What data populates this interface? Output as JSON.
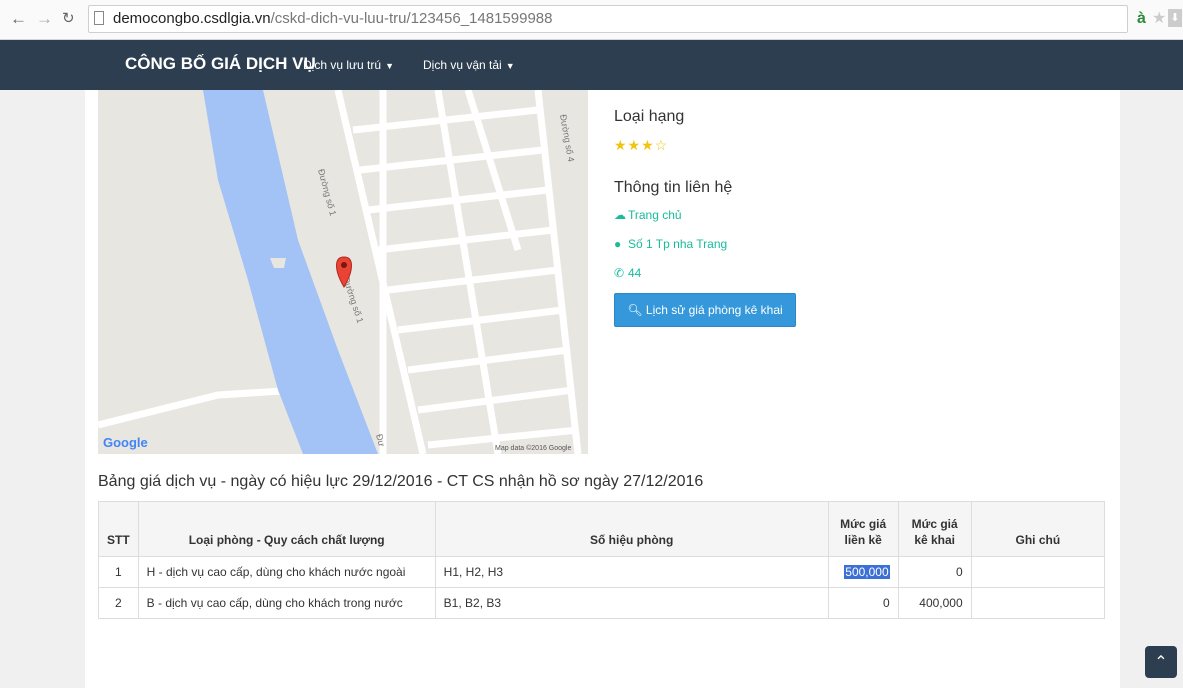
{
  "browser": {
    "url_host": "democongbo.csdlgia.vn",
    "url_path": "/cskd-dich-vu-luu-tru/123456_1481599988",
    "ext_icon": "à"
  },
  "navbar": {
    "brand": "CÔNG BỐ GIÁ DỊCH VỤ",
    "items": [
      {
        "label": "Dịch vụ lưu trú"
      },
      {
        "label": "Dịch vụ vận tải"
      }
    ]
  },
  "map": {
    "google_label": "Google",
    "attribution": "Map data ©2016 Google",
    "street_labels": [
      "Đường số 1",
      "Đường số 1",
      "Đường số 4",
      "Đư"
    ]
  },
  "info": {
    "rank_title": "Loại hạng",
    "stars": "★★★☆",
    "star_rating": 3,
    "contact_title": "Thông tin liên hệ",
    "homepage": "Trang chủ",
    "address": "Số 1 Tp nha Trang",
    "phone": "44",
    "history_button": "Lịch sử giá phòng kê khai"
  },
  "price_table": {
    "heading": "Bảng giá dịch vụ - ngày có hiệu lực 29/12/2016 - CT CS nhận hồ sơ ngày 27/12/2016",
    "columns": {
      "stt": "STT",
      "room_type": "Loại phòng - Quy cách chất lượng",
      "room_numbers": "Số hiệu phòng",
      "adjacent_price_1": "Mức giá",
      "adjacent_price_2": "liền kề",
      "declared_price_1": "Mức giá",
      "declared_price_2": "kê khai",
      "notes": "Ghi chú"
    },
    "rows": [
      {
        "stt": "1",
        "room_type": "H - dịch vụ cao cấp, dùng cho khách nước ngoài",
        "room_numbers": "H1, H2, H3",
        "adjacent_price": "500,000",
        "declared_price": "0",
        "notes": ""
      },
      {
        "stt": "2",
        "room_type": "B - dịch vụ cao cấp, dùng cho khách trong nước",
        "room_numbers": "B1, B2, B3",
        "adjacent_price": "0",
        "declared_price": "400,000",
        "notes": ""
      }
    ]
  },
  "colors": {
    "navbar": "#2c3e50",
    "accent_green": "#18bc9c",
    "button_blue": "#3498db",
    "star_gold": "#f1c40f",
    "water": "#a3c2f5"
  }
}
